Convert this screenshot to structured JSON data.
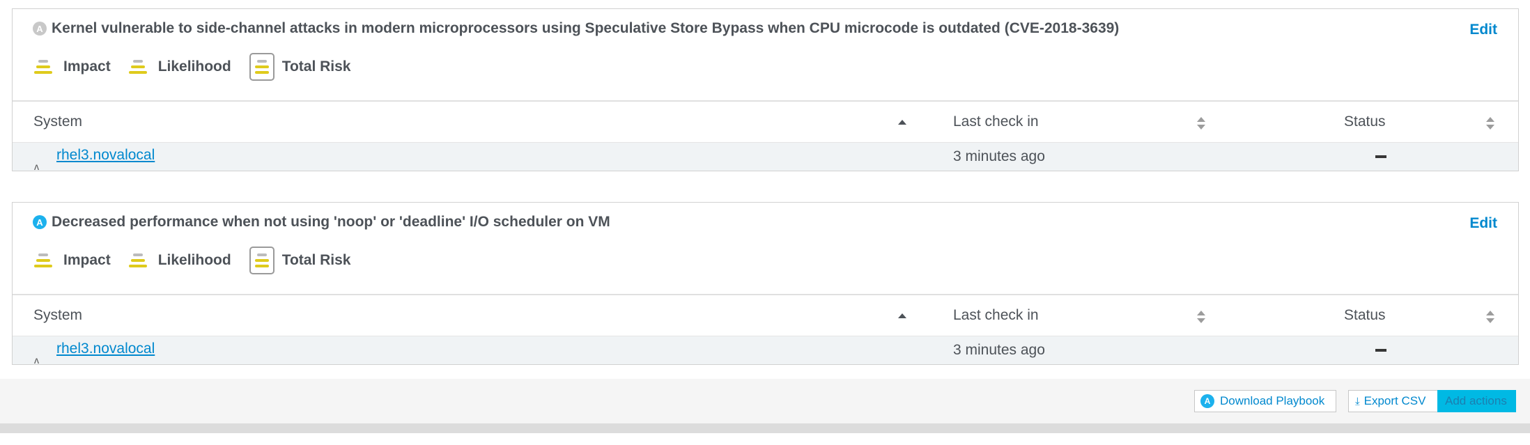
{
  "rules": [
    {
      "title": "Kernel vulnerable to side-channel attacks in modern microprocessors using Speculative Store Bypass when CPU microcode is outdated (CVE-2018-3639)",
      "ansible_badge": "A",
      "edit_label": "Edit",
      "risk": {
        "impact_label": "Impact",
        "likelihood_label": "Likelihood",
        "total_risk_label": "Total Risk"
      },
      "table": {
        "col_system": "System",
        "col_last_checkin": "Last check in",
        "col_status": "Status",
        "rows": [
          {
            "system": "rhel3.novalocal",
            "last_checkin": "3 minutes ago"
          }
        ]
      }
    },
    {
      "title": "Decreased performance when not using 'noop' or 'deadline' I/O scheduler on VM",
      "ansible_badge": "A",
      "edit_label": "Edit",
      "risk": {
        "impact_label": "Impact",
        "likelihood_label": "Likelihood",
        "total_risk_label": "Total Risk"
      },
      "table": {
        "col_system": "System",
        "col_last_checkin": "Last check in",
        "col_status": "Status",
        "rows": [
          {
            "system": "rhel3.novalocal",
            "last_checkin": "3 minutes ago"
          }
        ]
      }
    }
  ],
  "footer": {
    "download_playbook_label": "Download Playbook",
    "download_playbook_icon": "A",
    "export_csv_label": "Export CSV",
    "add_actions_label": "Add actions"
  }
}
